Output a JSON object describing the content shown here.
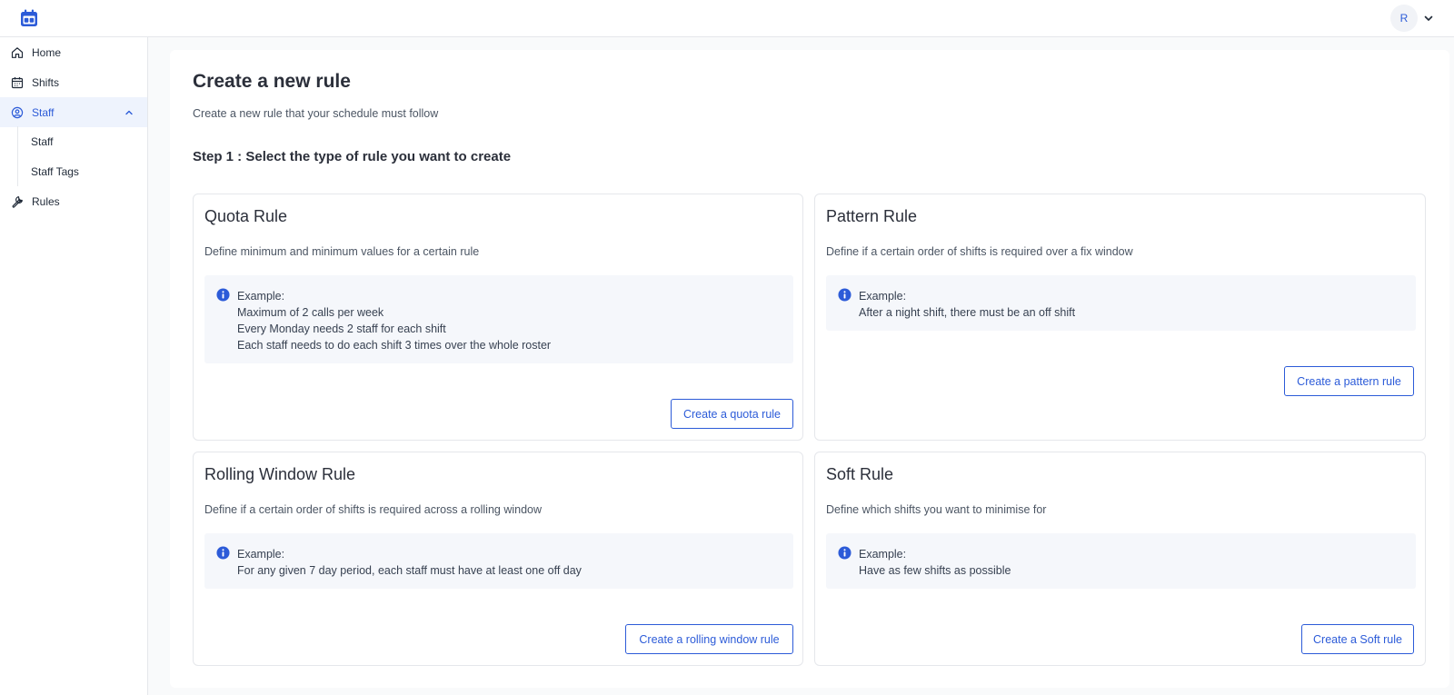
{
  "topbar": {
    "avatar_initial": "R"
  },
  "sidebar": {
    "items": [
      {
        "label": "Home",
        "icon": "home-icon"
      },
      {
        "label": "Shifts",
        "icon": "calendar-icon"
      },
      {
        "label": "Staff",
        "icon": "staff-icon",
        "expanded": true
      },
      {
        "label": "Rules",
        "icon": "wrench-icon"
      }
    ],
    "sub_items": [
      {
        "label": "Staff"
      },
      {
        "label": "Staff Tags"
      }
    ]
  },
  "page": {
    "title": "Create a new rule",
    "subtitle": "Create a new rule that your schedule must follow",
    "step_title": "Step 1 : Select the type of rule you want to create"
  },
  "cards": {
    "quota": {
      "title": "Quota Rule",
      "description": "Define minimum and minimum values for a certain rule",
      "example_label": "Example:",
      "examples": [
        "Maximum of 2 calls per week",
        "Every Monday needs 2 staff for each shift",
        "Each staff needs to do each shift 3 times over the whole roster"
      ],
      "button": "Create a quota rule"
    },
    "pattern": {
      "title": "Pattern Rule",
      "description": "Define if a certain order of shifts is required over a fix window",
      "example_label": "Example:",
      "examples": [
        "After a night shift, there must be an off shift"
      ],
      "button": "Create a pattern rule"
    },
    "rolling": {
      "title": "Rolling Window Rule",
      "description": "Define if a certain order of shifts is required across a rolling window",
      "example_label": "Example:",
      "examples": [
        "For any given 7 day period, each staff must have at least one off day"
      ],
      "button": "Create a rolling window rule"
    },
    "soft": {
      "title": "Soft Rule",
      "description": "Define which shifts you want to minimise for",
      "example_label": "Example:",
      "examples": [
        "Have as few shifts as possible"
      ],
      "button": "Create a Soft rule"
    }
  },
  "colors": {
    "accent": "#2c5bd8",
    "active_nav_bg": "#eef3fd",
    "example_bg": "#f5f7fb",
    "page_bg": "#f9fafb"
  }
}
